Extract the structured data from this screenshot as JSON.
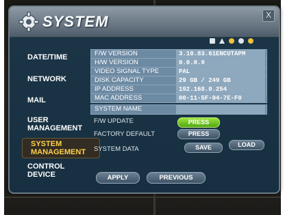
{
  "window": {
    "title": "SYSTEM",
    "close_label": "X"
  },
  "status_icons": [
    "lock-icon",
    "triangle-icon",
    "circle-icon",
    "star-icon",
    "dot-icon"
  ],
  "nav": [
    {
      "label": "DATE/TIME"
    },
    {
      "label": "NETWORK"
    },
    {
      "label": "MAIL"
    },
    {
      "label": "USER\nMANAGEMENT"
    },
    {
      "label": "SYSTEM\nMANAGEMENT",
      "active": true
    },
    {
      "label": "CONTROL\nDEVICE"
    }
  ],
  "info": [
    {
      "label": "F/W VERSION",
      "value": "3.10.83.61ENCUTAPM"
    },
    {
      "label": "H/W VERSION",
      "value": "0.0.0.9"
    },
    {
      "label": "VIDEO SIGNAL TYPE",
      "value": "PAL"
    },
    {
      "label": "DISK CAPACITY",
      "value": "29 GB / 249 GB"
    },
    {
      "label": "IP ADDRESS",
      "value": "192.168.0.254"
    },
    {
      "label": "MAC ADDRESS",
      "value": "00-11-5F-04-7E-F0"
    },
    {
      "label": "SYSTEM NAME",
      "value": ""
    }
  ],
  "actions": {
    "fw_update": {
      "label": "F/W UPDATE",
      "button": "PRESS"
    },
    "factory_default": {
      "label": "FACTORY DEFAULT",
      "button": "PRESS"
    },
    "system_data": {
      "label": "SYSTEM DATA",
      "save": "SAVE",
      "load": "LOAD"
    }
  },
  "footer": {
    "apply": "APPLY",
    "previous": "PREVIOUS"
  },
  "colors": {
    "accent_green": "#6fd11e",
    "active_nav": "#ffd24a",
    "panel": "#173041"
  }
}
